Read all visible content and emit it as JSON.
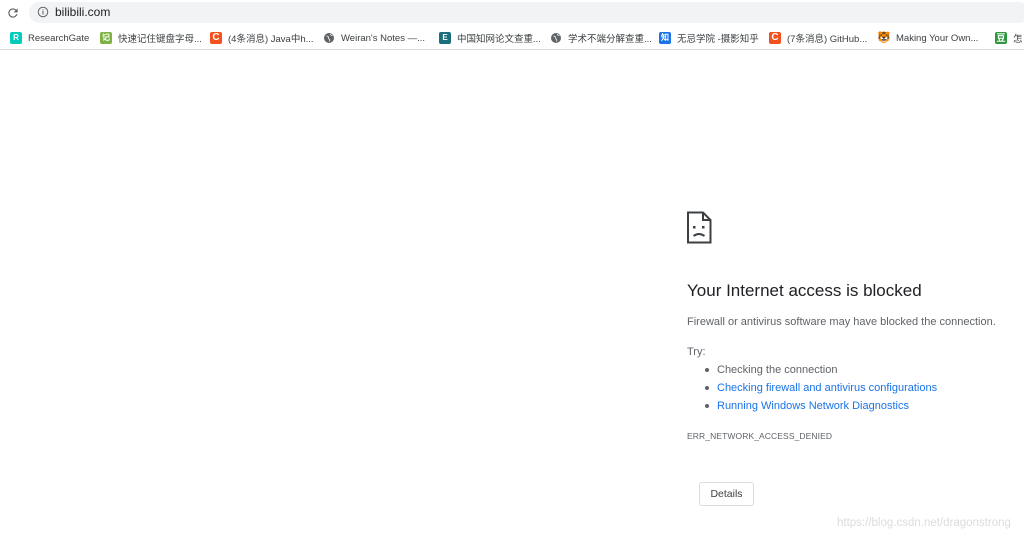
{
  "address_bar": {
    "url": "bilibili.com"
  },
  "bookmarks": [
    {
      "label": "ResearchGate",
      "icon": "researchgate-icon",
      "glyph": "R"
    },
    {
      "label": "快速记住键盘字母...",
      "icon": "green-app-icon",
      "glyph": "记"
    },
    {
      "label": "(4条消息) Java中h...",
      "icon": "csdn-icon",
      "glyph": "C"
    },
    {
      "label": "Weiran's Notes —...",
      "icon": "globe-icon",
      "glyph": ""
    },
    {
      "label": "中国知网论文查重...",
      "icon": "cnki-icon",
      "glyph": "E"
    },
    {
      "label": "学术不端分解查重...",
      "icon": "globe-icon",
      "glyph": ""
    },
    {
      "label": "无忌学院 -摄影知乎",
      "icon": "zhihu-icon",
      "glyph": "知"
    },
    {
      "label": "(7条消息) GitHub...",
      "icon": "csdn-icon",
      "glyph": "C"
    },
    {
      "label": "Making Your Own...",
      "icon": "emoji-icon",
      "glyph": "🐯"
    },
    {
      "label": "怎",
      "icon": "douban-icon",
      "glyph": "豆"
    }
  ],
  "error": {
    "title": "Your Internet access is blocked",
    "description": "Firewall or antivirus software may have blocked the connection.",
    "try_label": "Try:",
    "suggestions": [
      {
        "text": "Checking the connection",
        "link": false
      },
      {
        "text": "Checking firewall and antivirus configurations",
        "link": true
      },
      {
        "text": "Running Windows Network Diagnostics",
        "link": true
      }
    ],
    "code": "ERR_NETWORK_ACCESS_DENIED",
    "details_button": "Details"
  },
  "watermark": "https://blog.csdn.net/dragonstrong",
  "colors": {
    "link": "#1a73e8",
    "secondary_text": "#5f6368",
    "omnibox_bg": "#f1f3f4"
  }
}
